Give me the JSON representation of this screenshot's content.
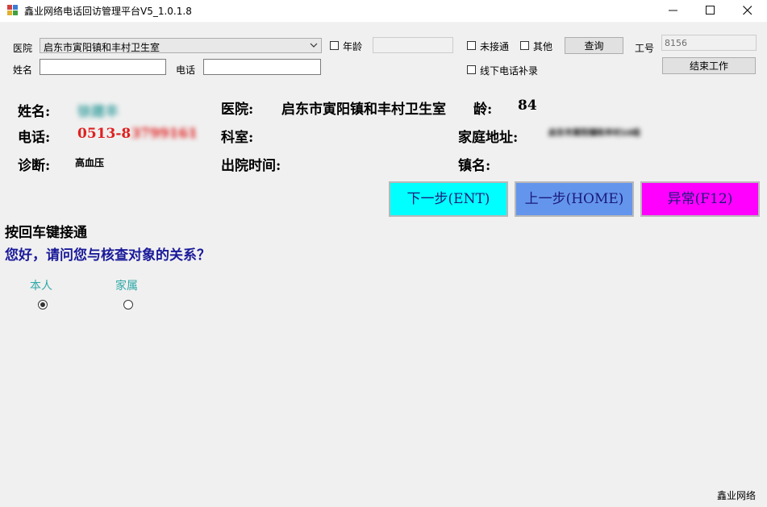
{
  "window": {
    "title": "鑫业网络电话回访管理平台V5_1.0.1.8",
    "minimize": "—",
    "close": "✕"
  },
  "search": {
    "hospital_label": "医院",
    "hospital_value": "启东市寅阳镇和丰村卫生室",
    "age_label": "年龄",
    "age_value": "",
    "name_label": "姓名",
    "name_value": "",
    "phone_label": "电话",
    "phone_value": "",
    "unconnected_label": "未接通",
    "other_label": "其他",
    "query_button": "查询",
    "offline_label": "线下电话补录",
    "staff_id_label": "工号",
    "staff_id_value": "8156",
    "end_work_button": "结束工作"
  },
  "patient": {
    "name_label": "姓名:",
    "name_value": "徐建丰",
    "hospital_label": "医院:",
    "hospital_value": "启东市寅阳镇和丰村卫生室",
    "age_label": "龄:",
    "age_value": "84",
    "phone_label": "电话:",
    "phone_value": "0513-83799161",
    "dept_label": "科室:",
    "address_label": "家庭地址:",
    "address_value": "启东市寅阳镇和丰村10组",
    "diagnosis_label": "诊断:",
    "diagnosis_value": "高血压",
    "discharge_label": "出院时间:",
    "town_label": "镇名:"
  },
  "actions": {
    "next": "下一步(ENT)",
    "prev": "上一步(HOME)",
    "abnormal": "异常(F12)"
  },
  "colors": {
    "next": "#00ffff",
    "prev": "#6495ed",
    "abnormal": "#ff00ff"
  },
  "script": {
    "hint": "按回车键接通",
    "question": "您好，请问您与核查对象的关系？",
    "options": [
      "本人",
      "家属"
    ],
    "selected": "本人"
  },
  "footer": {
    "brand": "鑫业网络"
  }
}
